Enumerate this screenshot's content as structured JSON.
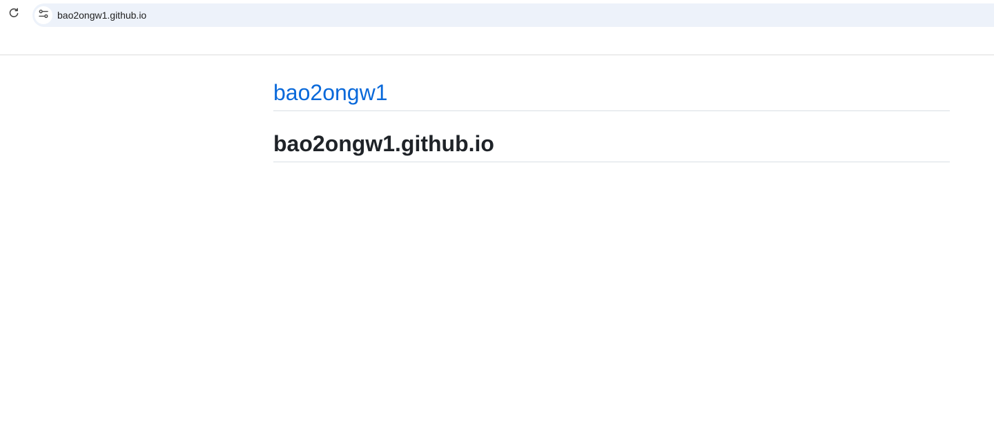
{
  "browser": {
    "url": "bao2ongw1.github.io",
    "reload_icon": "reload-icon",
    "site_info_icon": "tune-icon",
    "address_bar_color": "#edf2fa"
  },
  "page": {
    "site_title": "bao2ongw1",
    "heading": "bao2ongw1.github.io",
    "link_color": "#0969da",
    "text_color": "#1f2328"
  }
}
